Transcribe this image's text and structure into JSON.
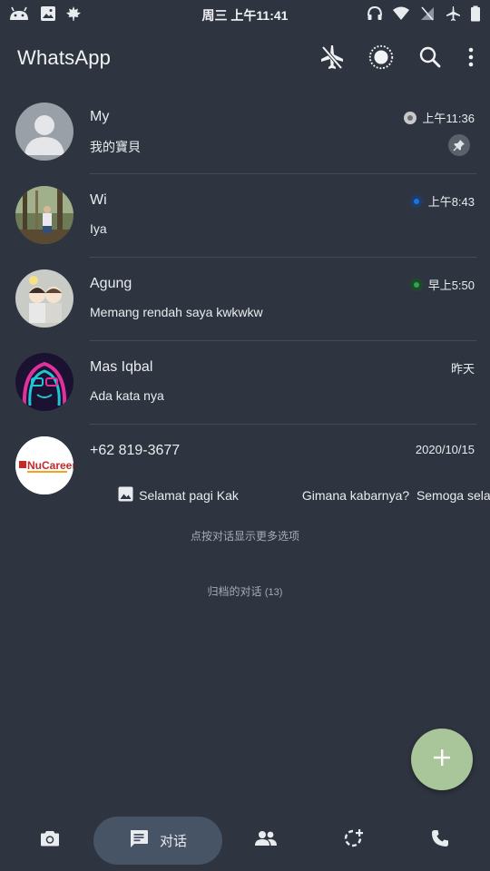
{
  "status_bar": {
    "time": "周三 上午11:41",
    "left_icons": [
      "android-icon",
      "image-icon",
      "maple-leaf-icon"
    ],
    "right_icons": [
      "headphones-icon",
      "wifi-icon",
      "no-signal-icon",
      "airplane-icon",
      "battery-icon"
    ]
  },
  "appbar": {
    "title": "WhatsApp",
    "actions": [
      "airplane-off-icon",
      "brightness-icon",
      "search-icon",
      "more-vert-icon"
    ]
  },
  "chats": [
    {
      "name": "My",
      "time": "上午11:36",
      "message": "我的寶貝",
      "status_color": "#c9c9c9",
      "pinned": true,
      "avatar": "default-avatar"
    },
    {
      "name": "Wi",
      "time": "上午8:43",
      "message": "Iya",
      "status_color": "#1a73e8",
      "pinned": false,
      "avatar": "photo-forest"
    },
    {
      "name": "Agung",
      "time": "早上5:50",
      "message": "Memang rendah saya kwkwkw",
      "status_color": "#2ea44f",
      "pinned": false,
      "avatar": "photo-cartoon-couple"
    },
    {
      "name": "Mas Iqbal",
      "time": "昨天",
      "message": "Ada kata nya",
      "status_color": "",
      "pinned": false,
      "avatar": "photo-neon-art"
    },
    {
      "name": "+62 819-3677",
      "time": "2020/10/15",
      "message": "Selamat pagi Kak                  Gimana kabarnya?  Semoga selalu...",
      "status_color": "",
      "pinned": false,
      "avatar": "logo-nucareer",
      "avatar_logo_text": "NuCareer"
    }
  ],
  "hints": {
    "tap_hint": "点按对话显示更多选项",
    "archived": "归档的对话",
    "archived_count": "(13)"
  },
  "fab": {
    "icon": "plus-icon"
  },
  "bottom_nav": {
    "items": [
      "camera-icon",
      "chat-icon",
      "community-icon",
      "status-icon",
      "call-icon"
    ],
    "active_label": "对话"
  },
  "colors": {
    "background": "#2f3540",
    "active_tab": "#465466",
    "fab": "#a8c69a",
    "divider": "#444b57"
  }
}
